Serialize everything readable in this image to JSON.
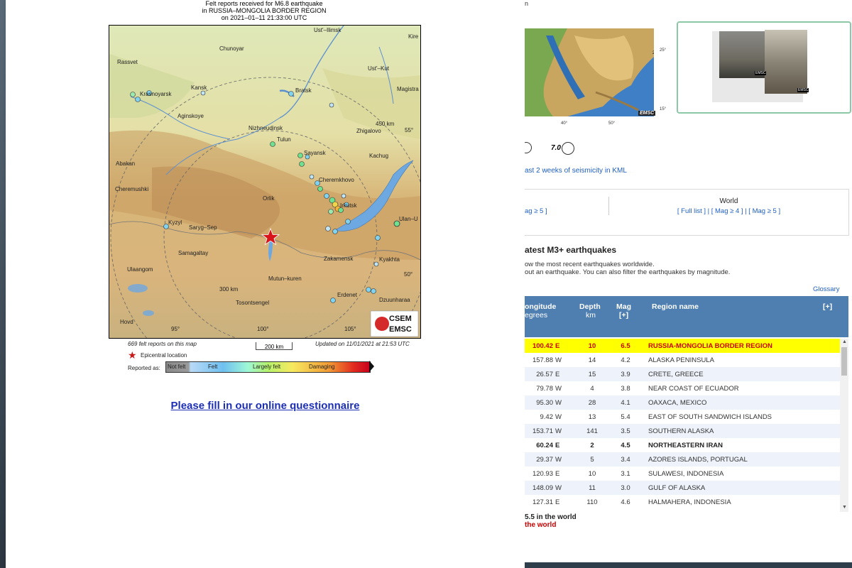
{
  "popup": {
    "header": {
      "line1": "Felt reports received for M6.8 earthquake",
      "line2": "in RUSSIA–MONGOLIA BORDER REGION",
      "line3": "on  2021–01–11 21:33:00 UTC"
    },
    "map_labels": {
      "ust_ilimsk": "Ust'–Ilimsk",
      "kirensk": "Kire",
      "chunoyar": "Chunoyar",
      "rassvet": "Rassvet",
      "ust_kut": "Ust'–Kut",
      "krasnoyarsk": "Krasnoyarsk",
      "kansk": "Kansk",
      "bratsk": "Bratsk",
      "magistral": "Magistra",
      "aginskoye": "Aginskoye",
      "nizhneudinsk": "Nizhneudinsk",
      "tulun": "Tulun",
      "zhigalovo": "Zhigalovo",
      "lat55": "55°",
      "km450": "450 km",
      "sayansk": "Sayansk",
      "kachug": "Kachug",
      "abakan": "Abakan",
      "cheremkhovo": "Cheremkhovo",
      "cheremushki": "Cheremushki",
      "orlik": "Orlik",
      "irkutsk": "Irkutsk",
      "ulan_ude": "Ulan–U",
      "kyzyl": "Kyzyl",
      "saryg_sep": "Saryg–Sep",
      "samagaltay": "Samagaltay",
      "zakamensk": "Zakamensk",
      "kyakhta": "Kyakhta",
      "ulaangom": "Ulaangom",
      "lat50": "50°",
      "mutun_kuren": "Mutun–kuren",
      "km300": "300 km",
      "erdenet": "Erdenet",
      "dzuunharaa": "Dzuunharaa",
      "tosontsengel": "Tosontsengel",
      "hovd": "Hovd",
      "lon95": "95°",
      "lon100": "100°",
      "lon105": "105°",
      "logo_top": "CSEM",
      "logo_bottom": "EMSC"
    },
    "felt_count": "669 felt reports on this map",
    "scale": "200 km",
    "updated": "Updated on 11/01/2021 at 21:53 UTC",
    "epicentral_label": "Epicentral location",
    "reported_as": "Reported as:",
    "colorbar_labels": [
      "Not felt",
      "Felt",
      "Largely felt",
      "Damaging"
    ],
    "questionnaire": "Please fill in our online questionnaire"
  },
  "right": {
    "top_char": "n",
    "map_ticks": {
      "lat25": "25°",
      "lat15": "15°",
      "lon40": "40°",
      "lon50": "50°",
      "logo": "EMSC"
    },
    "photo_badge": "EMSC",
    "mag_legend": "7.0",
    "kml_link": "ast 2 weeks of seismicity in KML",
    "filter_left": "ag ≥ 5 ]",
    "world_title": "World",
    "world_links": "[ Full list ] | [ Mag ≥ 4 ] | [ Mag ≥ 5 ]",
    "latest_title": "atest M3+ earthquakes",
    "desc1": "ow the most recent earthquakes worldwide.",
    "desc2": "out an earthquake. You can also filter the earthquakes by magnitude.",
    "glossary": "Glossary",
    "headers": {
      "lon1": "ongitude",
      "lon2": "egrees",
      "depth1": "Depth",
      "depth2": "km",
      "mag1": "Mag",
      "mag2": "[+]",
      "region": "Region name",
      "plus": "[+]"
    },
    "rows": [
      {
        "lon": "100.42",
        "dir": "E",
        "depth": "10",
        "mag": "6.5",
        "region": "RUSSIA-MONGOLIA BORDER REGION",
        "style": "high"
      },
      {
        "lon": "157.88",
        "dir": "W",
        "depth": "14",
        "mag": "4.2",
        "region": "ALASKA PENINSULA",
        "style": ""
      },
      {
        "lon": "26.57",
        "dir": "E",
        "depth": "15",
        "mag": "3.9",
        "region": "CRETE, GREECE",
        "style": ""
      },
      {
        "lon": "79.78",
        "dir": "W",
        "depth": "4",
        "mag": "3.8",
        "region": "NEAR COAST OF ECUADOR",
        "style": ""
      },
      {
        "lon": "95.30",
        "dir": "W",
        "depth": "28",
        "mag": "4.1",
        "region": "OAXACA, MEXICO",
        "style": ""
      },
      {
        "lon": "9.42",
        "dir": "W",
        "depth": "13",
        "mag": "5.4",
        "region": "EAST OF SOUTH SANDWICH ISLANDS",
        "style": ""
      },
      {
        "lon": "153.71",
        "dir": "W",
        "depth": "141",
        "mag": "3.5",
        "region": "SOUTHERN ALASKA",
        "style": ""
      },
      {
        "lon": "60.24",
        "dir": "E",
        "depth": "2",
        "mag": "4.5",
        "region": "NORTHEASTERN IRAN",
        "style": "bold"
      },
      {
        "lon": "29.37",
        "dir": "W",
        "depth": "5",
        "mag": "3.4",
        "region": "AZORES ISLANDS, PORTUGAL",
        "style": ""
      },
      {
        "lon": "120.93",
        "dir": "E",
        "depth": "10",
        "mag": "3.1",
        "region": "SULAWESI, INDONESIA",
        "style": ""
      },
      {
        "lon": "148.09",
        "dir": "W",
        "depth": "11",
        "mag": "3.0",
        "region": "GULF OF ALASKA",
        "style": ""
      },
      {
        "lon": "127.31",
        "dir": "E",
        "depth": "110",
        "mag": "4.6",
        "region": "HALMAHERA, INDONESIA",
        "style": ""
      }
    ],
    "world_line1": "5.5 in the world",
    "world_line2": "the world"
  },
  "colors": {
    "highlight": "#ffff00",
    "header_blue": "#4f7fb1",
    "link": "#1c2fb4",
    "accent_red": "#cc0000"
  }
}
